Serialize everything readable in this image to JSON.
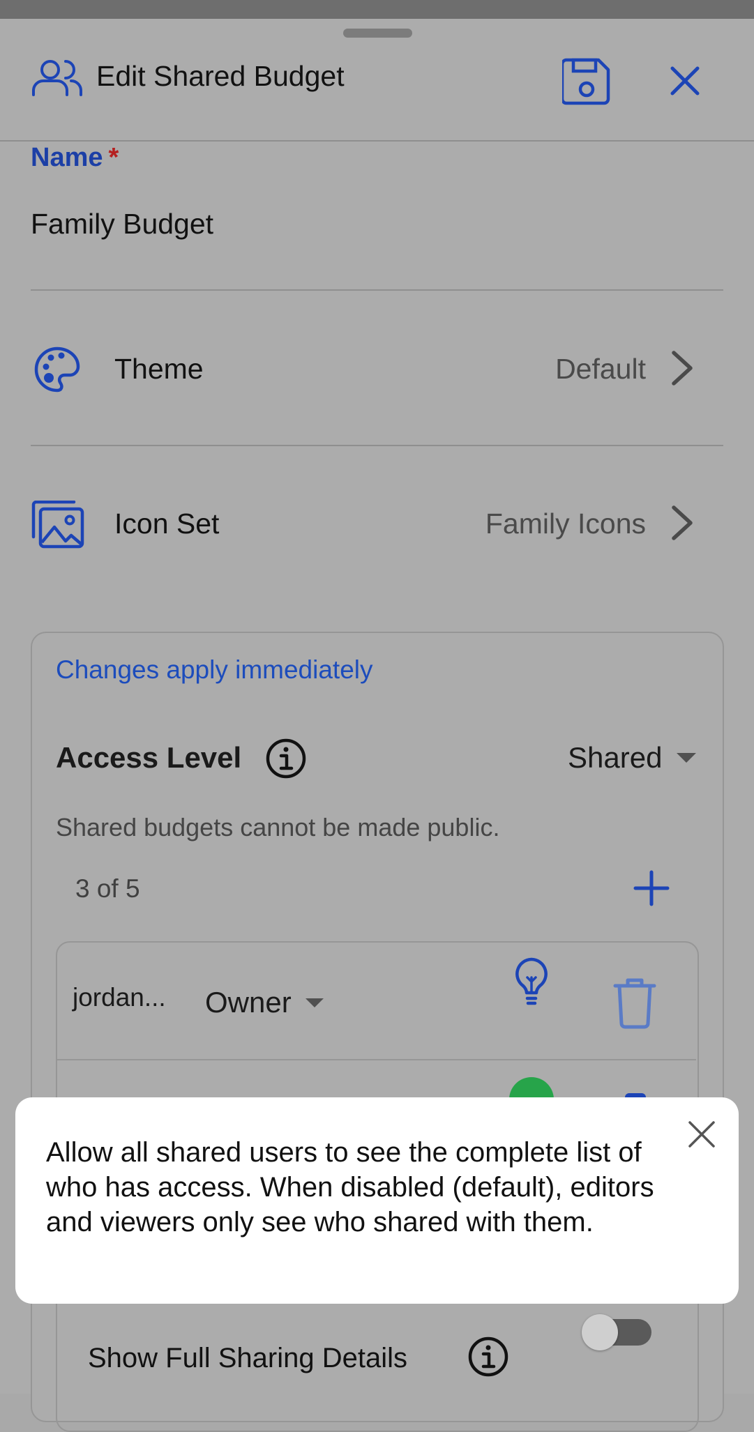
{
  "header": {
    "title": "Edit Shared Budget",
    "icons": [
      "users-icon",
      "save-icon",
      "close-icon"
    ]
  },
  "form": {
    "name_label": "Name",
    "required_mark": "*",
    "name_value": "Family Budget",
    "theme": {
      "label": "Theme",
      "value": "Default",
      "icon": "palette-icon"
    },
    "icon_set": {
      "label": "Icon Set",
      "value": "Family Icons",
      "icon": "image-icon"
    }
  },
  "sharing": {
    "changes_notice": "Changes apply immediately",
    "access_level_label": "Access Level",
    "access_level_value": "Shared",
    "note": "Shared budgets cannot be made public.",
    "count": "3 of 5",
    "users": [
      {
        "name": "jordan...",
        "role": "Owner"
      }
    ],
    "show_full_label": "Show Full Sharing Details",
    "show_full_enabled": false
  },
  "tooltip": {
    "text": "Allow all shared users to see the complete list of who has access. When disabled (default), editors and viewers only see who shared with them."
  },
  "colors": {
    "accent": "#1c44b6",
    "required": "#b52020",
    "success": "#27a44a"
  }
}
